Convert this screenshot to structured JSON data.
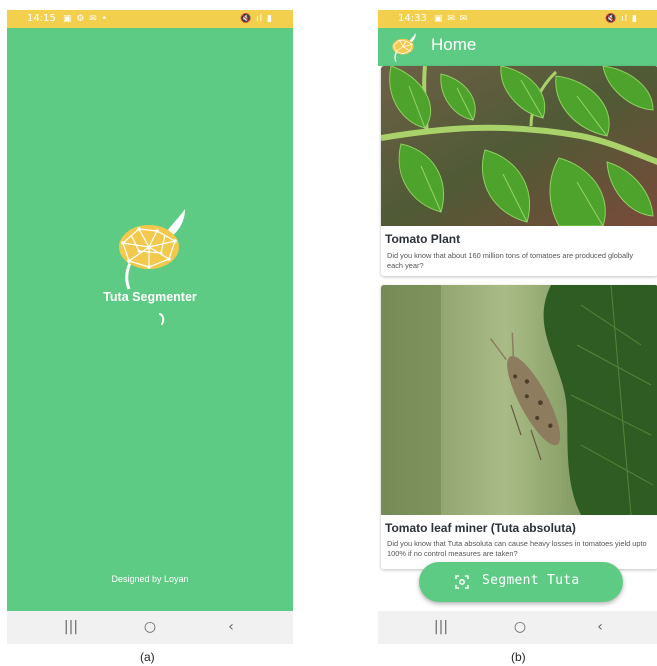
{
  "screens": [
    {
      "status_time": "14:15",
      "status_left_icons": "▣ ⚙ ✉ •",
      "status_right_icons": "🔇 ıl ▮",
      "splash": {
        "title": "Tuta Segmenter",
        "footer": "Designed by Loyan"
      },
      "nav": [
        "|||",
        "○",
        "‹"
      ],
      "caption": "(a)"
    },
    {
      "status_time": "14:33",
      "status_left_icons": "▣ ✉ ✉",
      "status_right_icons": "🔇 ıl ▮",
      "appbar_title": "Home",
      "cards": [
        {
          "title": "Tomato Plant",
          "text": "Did you know that about 160 million tons of tomatoes are produced globally each year?"
        },
        {
          "title": "Tomato leaf miner (Tuta absoluta)",
          "text": "Did you know that Tuta absoluta can cause heavy losses in tomatoes yield upto 100% if no control measures are taken?"
        }
      ],
      "fab_label": "Segment Tuta",
      "nav": [
        "|||",
        "○",
        "‹"
      ],
      "caption": "(b)"
    }
  ],
  "colors": {
    "primary_green": "#5ecb85",
    "status_yellow": "#f2d04d",
    "logo_yellow": "#f2c94c"
  }
}
